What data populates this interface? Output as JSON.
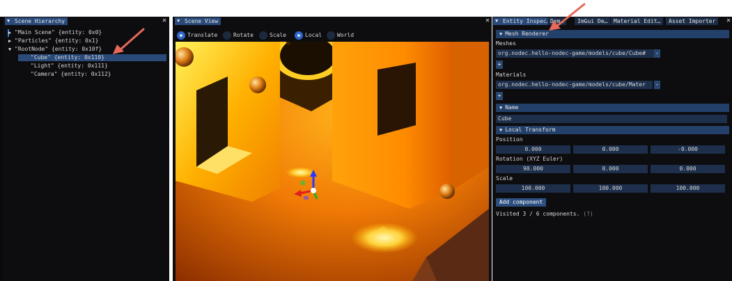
{
  "hierarchy": {
    "tab_label": "Scene Hierarchy",
    "close_glyph": "✕",
    "items": [
      {
        "arrow": "▶",
        "label": "\"Main Scene\" {entity: 0x0}"
      },
      {
        "arrow": "▶",
        "label": "\"Particles\" {entity: 0x1}"
      },
      {
        "arrow": "▼",
        "label": "\"RootNode\" {entity: 0x10f}"
      },
      {
        "arrow": "",
        "label": "\"Cube\" {entity: 0x110}"
      },
      {
        "arrow": "",
        "label": "\"Light\" {entity: 0x111}"
      },
      {
        "arrow": "",
        "label": "\"Camera\" {entity: 0x112}"
      }
    ]
  },
  "scene_view": {
    "tab_label": "Scene View",
    "close_glyph": "✕",
    "modes": [
      {
        "label": "Translate",
        "selected": true
      },
      {
        "label": "Rotate",
        "selected": false
      },
      {
        "label": "Scale",
        "selected": false
      }
    ],
    "spaces": [
      {
        "label": "Local",
        "selected": true
      },
      {
        "label": "World",
        "selected": false
      }
    ]
  },
  "inspector": {
    "tabs": [
      "Entity Inspec…",
      "Dem…",
      "ImGui De…",
      "Material Edit…",
      "Asset Importer"
    ],
    "close_glyph": "✕",
    "mesh_renderer": {
      "header": "Mesh Renderer",
      "meshes_label": "Meshes",
      "mesh_value": "org.nodec.hello-nodec-game/models/cube/Cube#",
      "materials_label": "Materials",
      "material_value": "org.nodec.hello-nodec-game/models/cube/Mater",
      "remove_label": "-",
      "add_label": "+"
    },
    "name": {
      "header": "Name",
      "value": "Cube"
    },
    "local_transform": {
      "header": "Local Transform",
      "position_label": "Position",
      "position": [
        "0.000",
        "0.000",
        "-0.000"
      ],
      "rotation_label": "Rotation (XYZ Euler)",
      "rotation": [
        "90.000",
        "0.000",
        "0.000"
      ],
      "scale_label": "Scale",
      "scale": [
        "100.000",
        "100.000",
        "100.000"
      ]
    },
    "add_component_label": "Add component",
    "visited_text": "Visited 3 / 6 components.",
    "help_marker": "(?)"
  },
  "colors": {
    "accent": "#2e67c9",
    "tab_active": "#294a7a",
    "annotation_arrow": "#e8685a"
  }
}
